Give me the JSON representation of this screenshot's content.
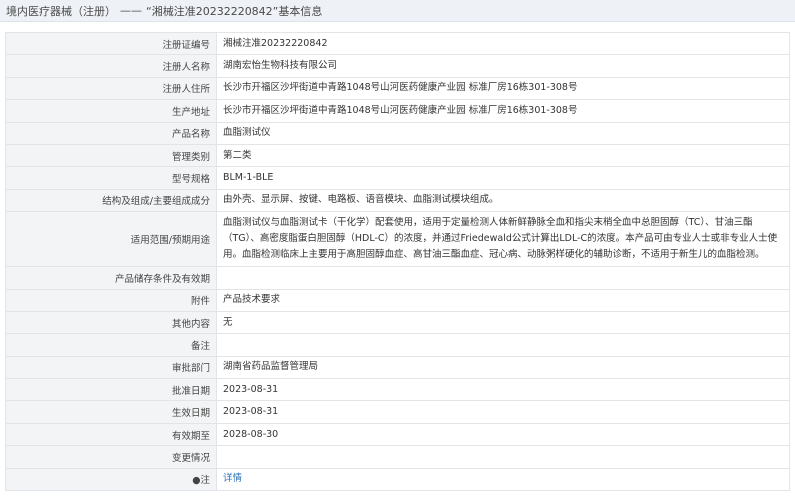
{
  "header": {
    "category": "境内医疗器械（注册）",
    "separator": "——",
    "title": "“湘械注准20232220842”基本信息"
  },
  "rows": [
    {
      "label": "注册证编号",
      "value": "湘械注准20232220842"
    },
    {
      "label": "注册人名称",
      "value": "湖南宏怡生物科技有限公司"
    },
    {
      "label": "注册人住所",
      "value": "长沙市开福区沙坪街道中青路1048号山河医药健康产业园 标准厂房16栋301-308号"
    },
    {
      "label": "生产地址",
      "value": "长沙市开福区沙坪街道中青路1048号山河医药健康产业园 标准厂房16栋301-308号"
    },
    {
      "label": "产品名称",
      "value": "血脂测试仪"
    },
    {
      "label": "管理类别",
      "value": "第二类"
    },
    {
      "label": "型号规格",
      "value": "BLM-1-BLE"
    },
    {
      "label": "结构及组成/主要组成成分",
      "value": "由外壳、显示屏、按键、电路板、语音模块、血脂测试模块组成。"
    },
    {
      "label": "适用范围/预期用途",
      "value": "血脂测试仪与血脂测试卡（干化学）配套使用，适用于定量检测人体新鲜静脉全血和指尖末梢全血中总胆固醇（TC）、甘油三酯（TG）、高密度脂蛋白胆固醇（HDL-C）的浓度，并通过Friedewald公式计算出LDL-C的浓度。本产品可由专业人士或非专业人士使用。血脂检测临床上主要用于高胆固醇血症、高甘油三酯血症、冠心病、动脉粥样硬化的辅助诊断，不适用于新生儿的血脂检测。"
    },
    {
      "label": "产品储存条件及有效期",
      "value": ""
    },
    {
      "label": "附件",
      "value": "产品技术要求"
    },
    {
      "label": "其他内容",
      "value": "无"
    },
    {
      "label": "备注",
      "value": ""
    },
    {
      "label": "审批部门",
      "value": "湖南省药品监督管理局"
    },
    {
      "label": "批准日期",
      "value": "2023-08-31"
    },
    {
      "label": "生效日期",
      "value": "2023-08-31"
    },
    {
      "label": "有效期至",
      "value": "2028-08-30"
    },
    {
      "label": "变更情况",
      "value": ""
    },
    {
      "label": "●注",
      "value": "详情"
    }
  ],
  "colors": {
    "header_bg": "#eef1f5",
    "label_bg": "#f3f4f6",
    "border": "#e1e4e8",
    "link": "#2a6fb8"
  }
}
